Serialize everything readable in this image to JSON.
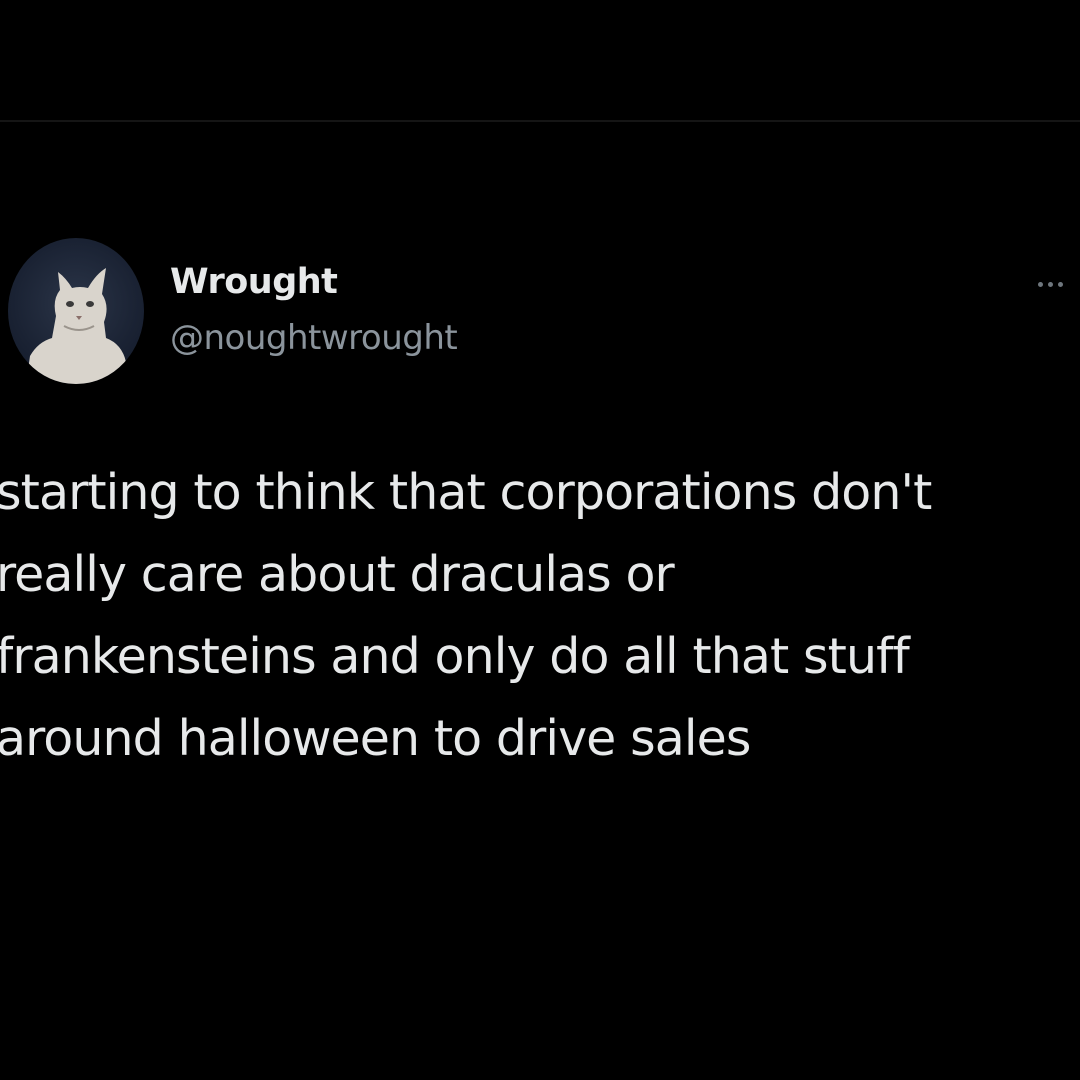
{
  "tweet": {
    "author": {
      "display_name": "Wrought",
      "handle": "@noughtwrought",
      "avatar_icon": "cat-avatar"
    },
    "more_icon": "more-horizontal-icon",
    "text_lines": [
      "starting to think that corporations don't",
      "really care about draculas or",
      "frankensteins and only do all that stuff",
      "around halloween to drive sales"
    ]
  },
  "colors": {
    "background": "#000000",
    "primary_text": "#e7e9ea",
    "secondary_text": "#8b949c"
  }
}
